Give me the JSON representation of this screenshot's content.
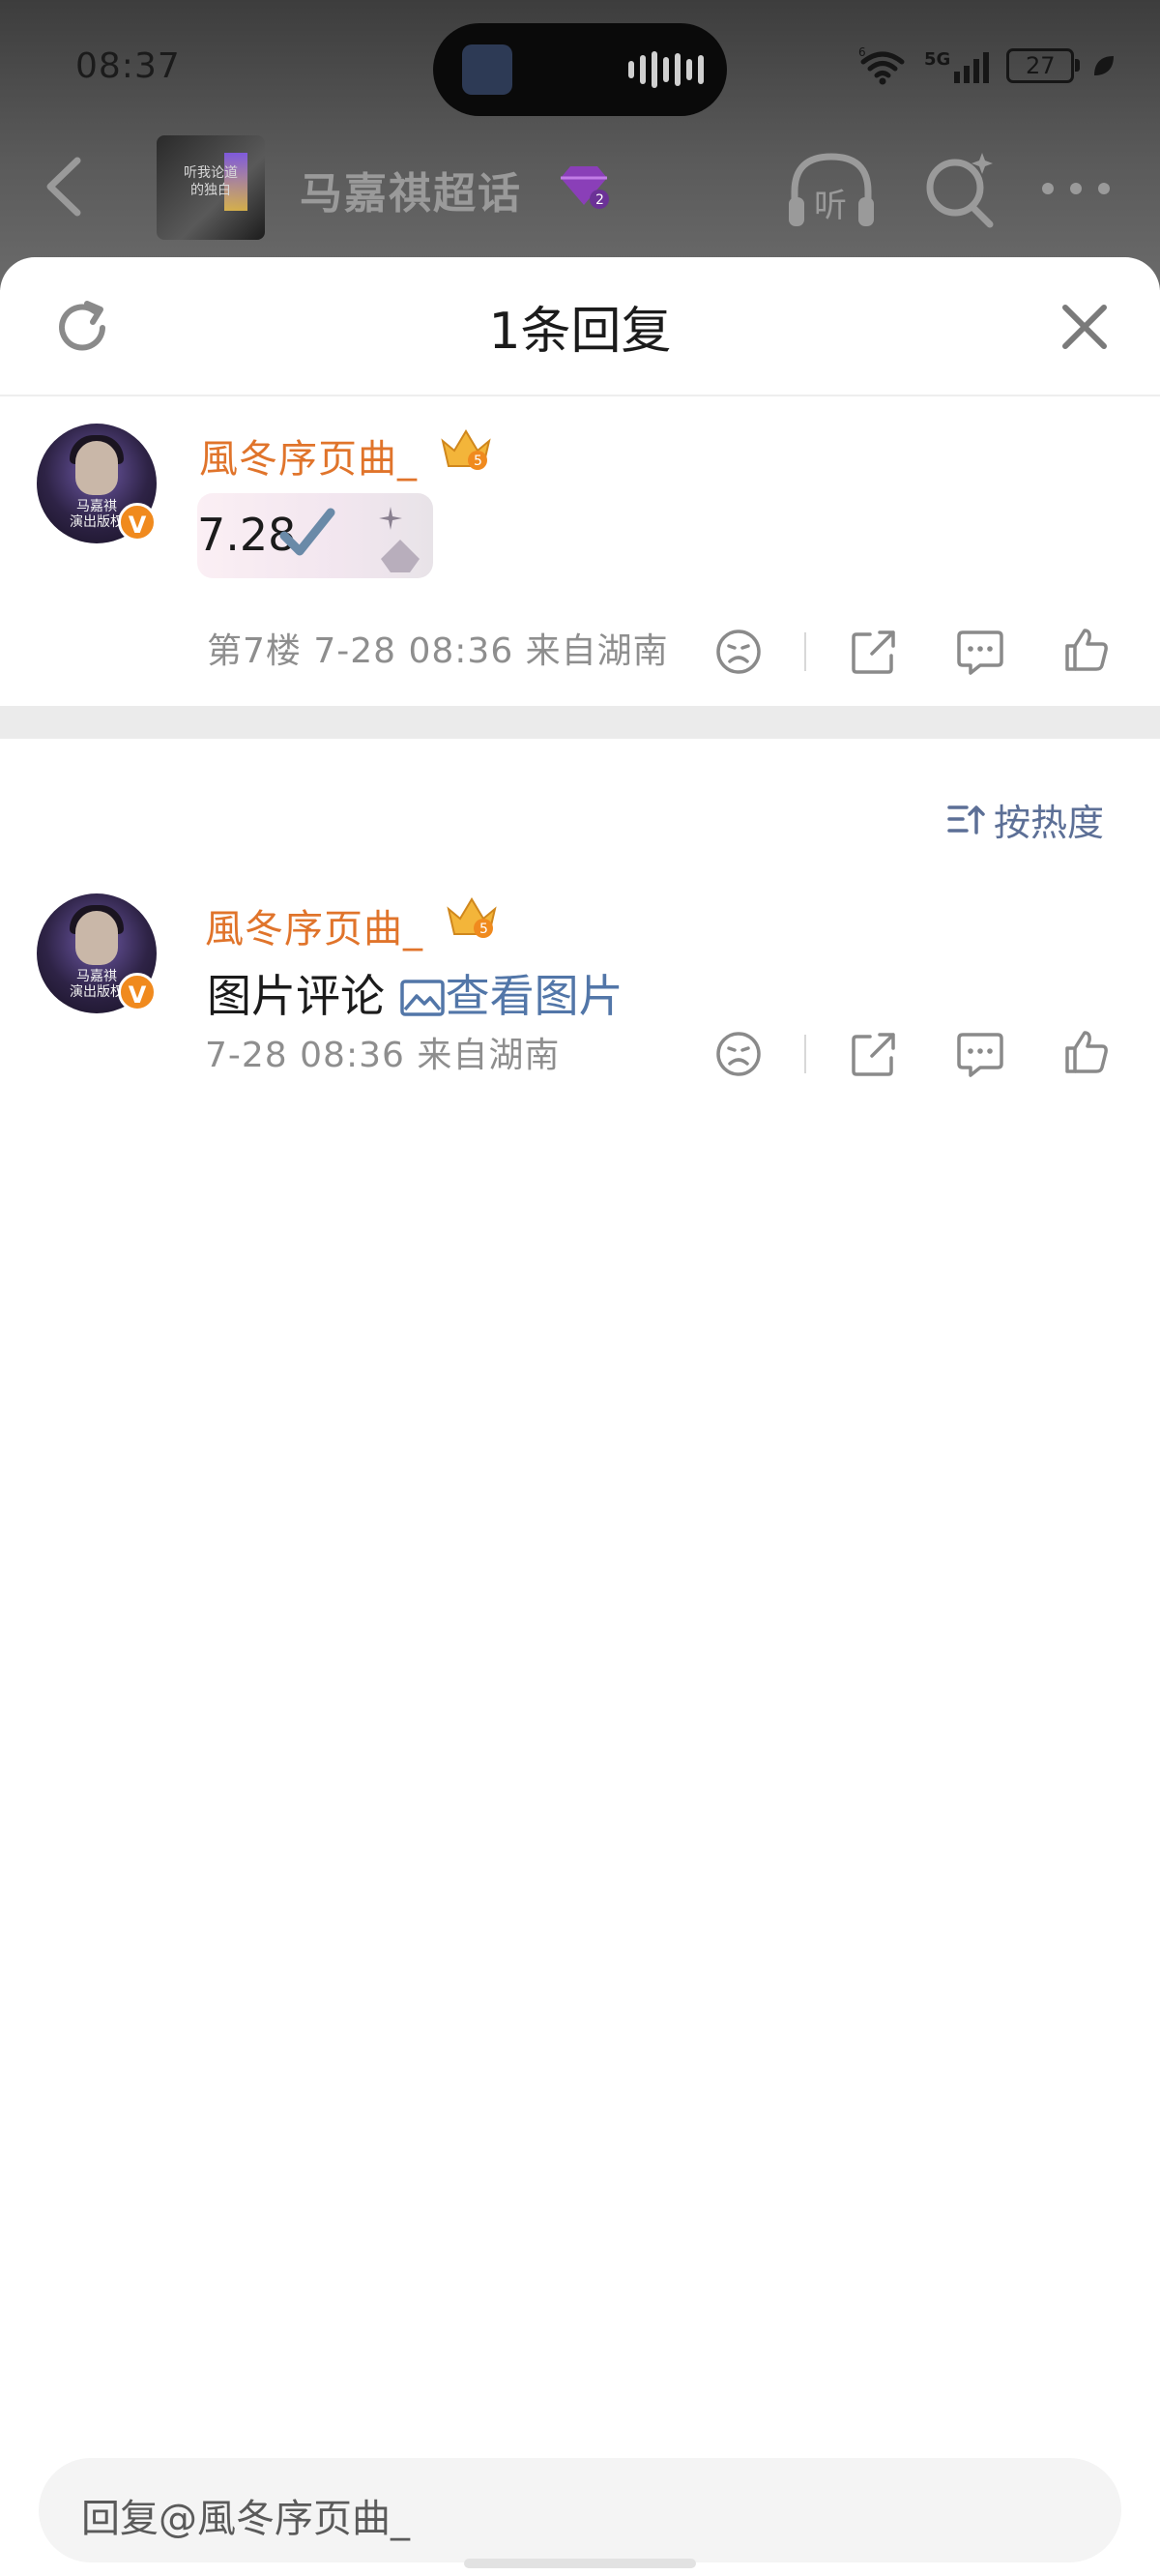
{
  "status_bar": {
    "time": "08:37",
    "network": "5G",
    "wifi_badge": "6",
    "battery": "27"
  },
  "nav": {
    "topic_title": "马嘉祺超话",
    "topic_thumb_text": "听我论道\n的独白",
    "listen_label": "听",
    "gem_level": "2"
  },
  "sheet": {
    "title": "1条回复",
    "main_comment": {
      "username": "風冬序页曲_",
      "crown_level": "5",
      "text": "7.28",
      "meta": "第7楼 7-28 08:36 来自湖南",
      "avatar_caption": "马嘉祺\n演出版权"
    },
    "sort_label": "按热度",
    "reply": {
      "username": "風冬序页曲_",
      "crown_level": "5",
      "text": "图片评论",
      "link_text": "查看图片",
      "meta": "7-28 08:36 来自湖南",
      "avatar_caption": "马嘉祺\n演出版权"
    },
    "reply_placeholder": "回复@風冬序页曲_"
  },
  "colors": {
    "username": "#e0742b",
    "link": "#5276a8",
    "meta": "#8e8e8e",
    "v_badge": "#f08a1e"
  }
}
